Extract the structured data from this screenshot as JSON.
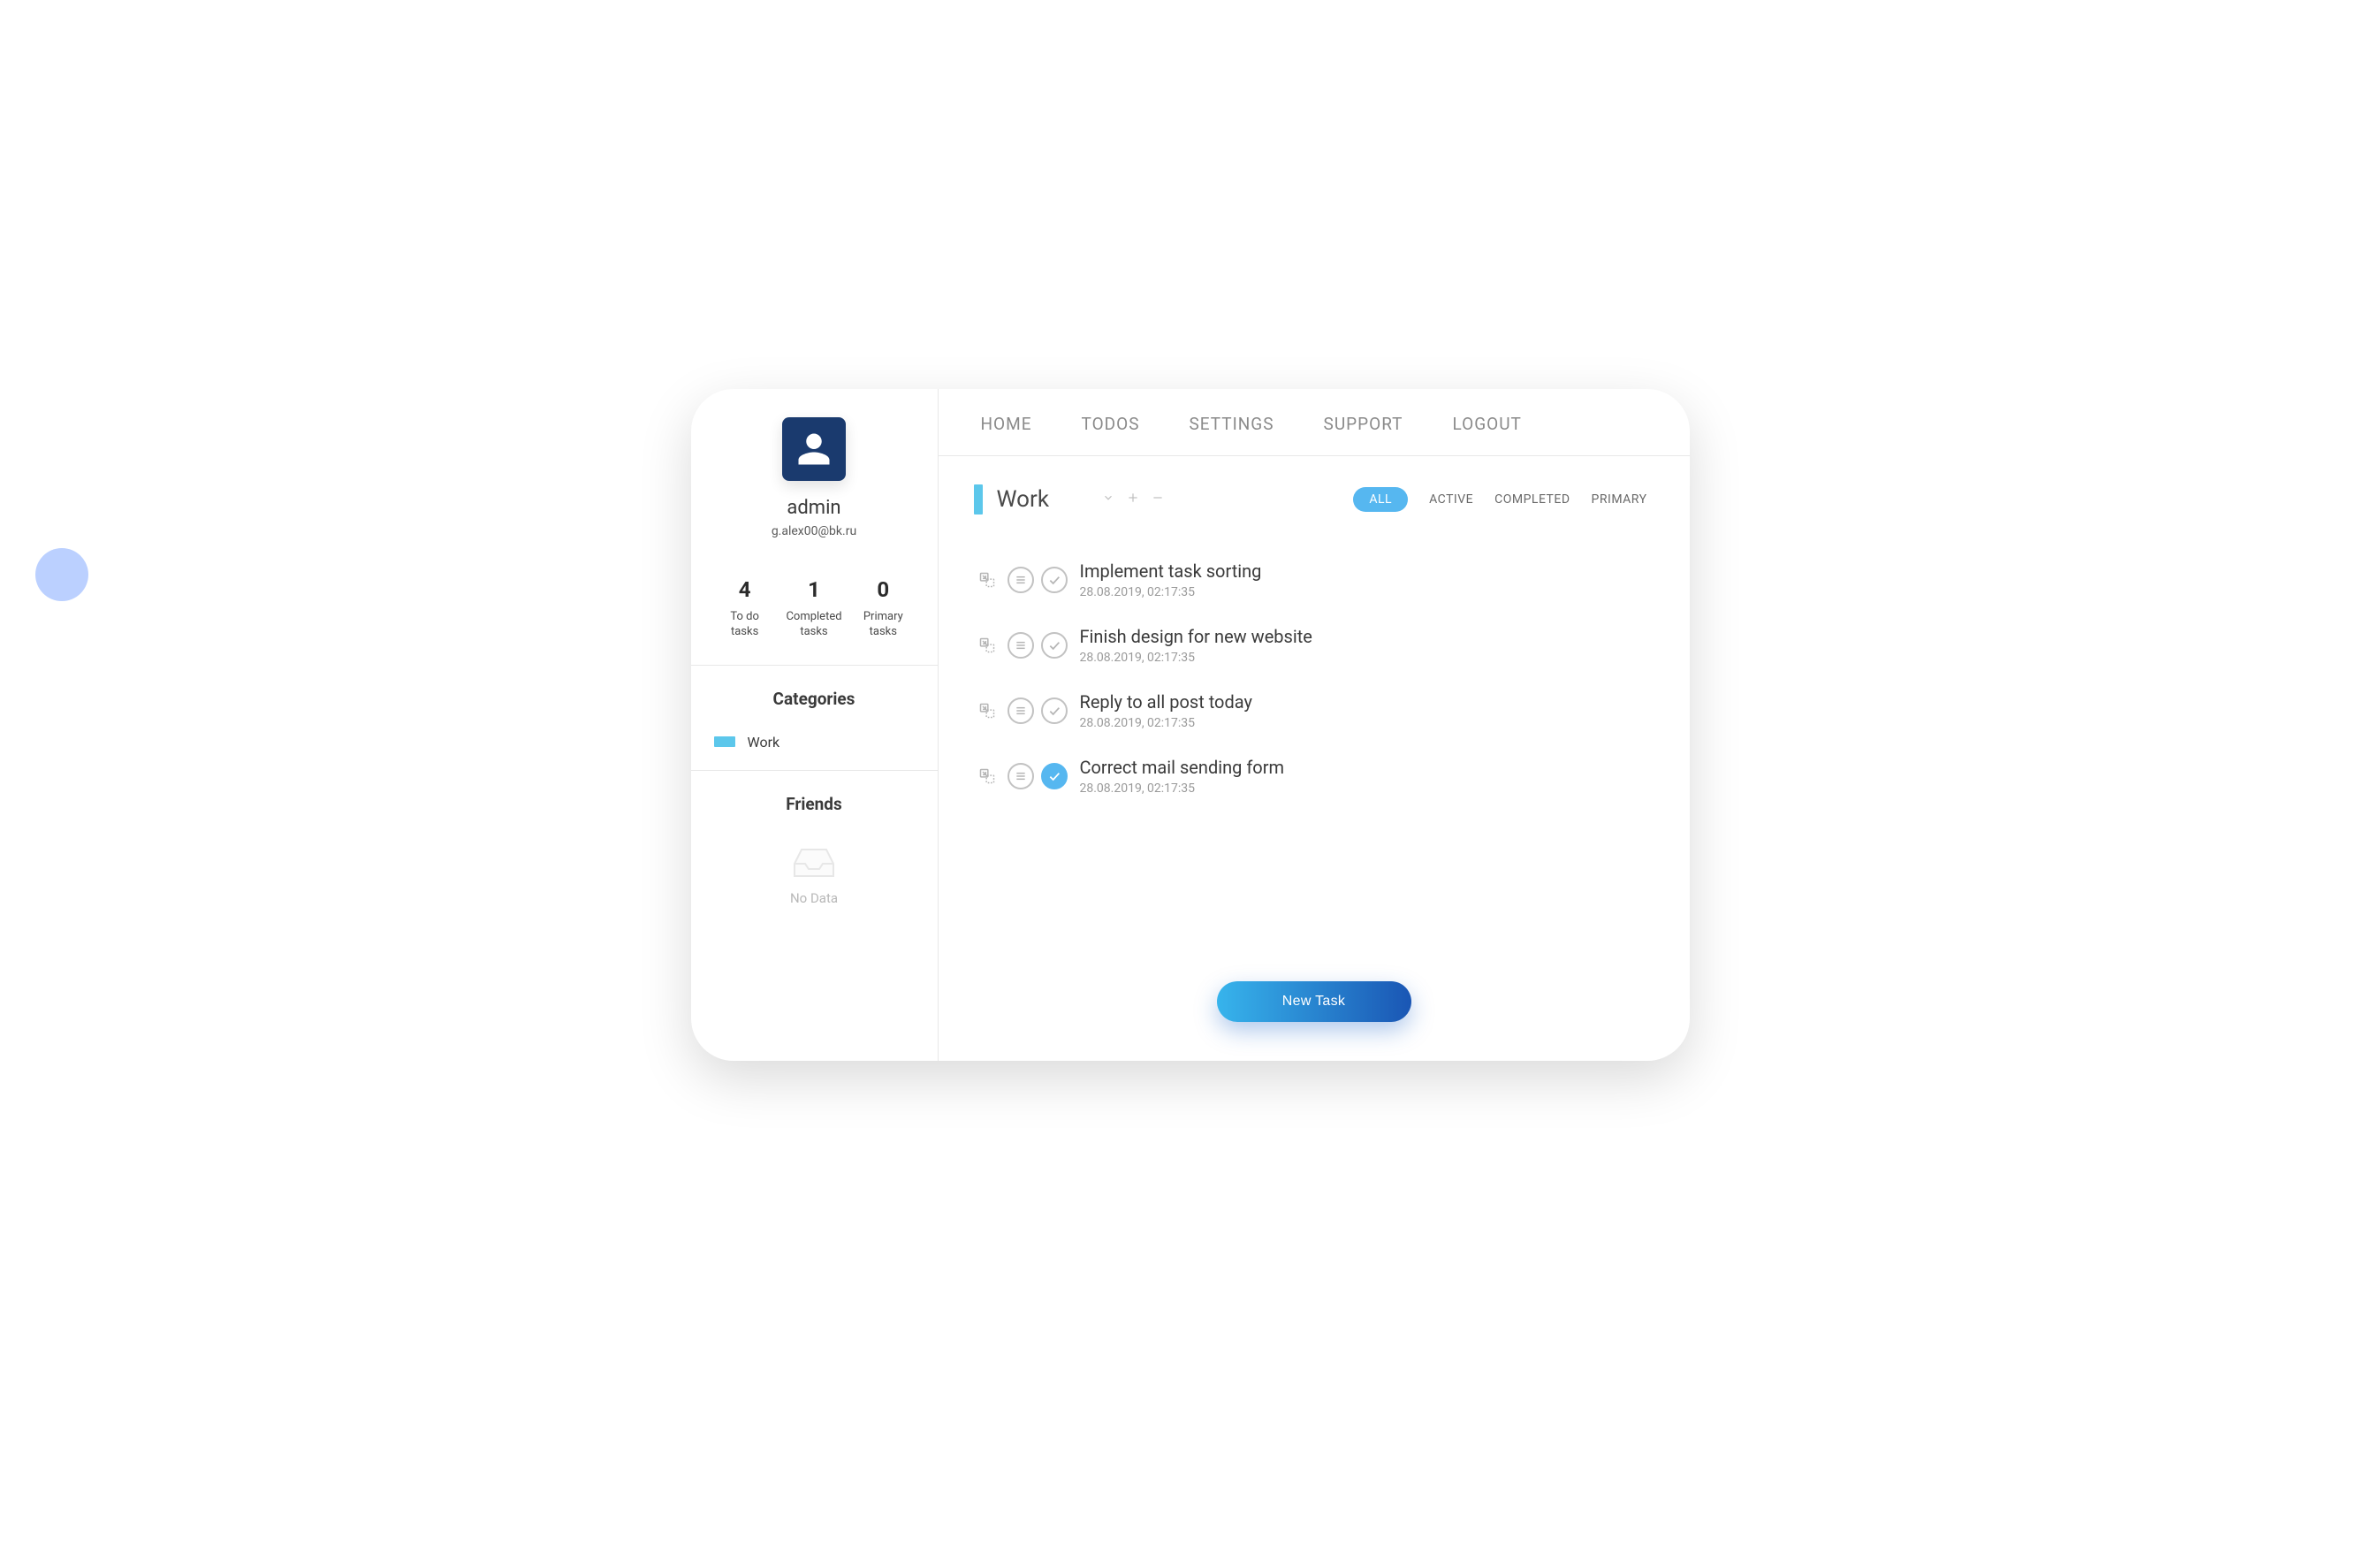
{
  "profile": {
    "username": "admin",
    "email": "g.alex00@bk.ru"
  },
  "stats": [
    {
      "value": "4",
      "label1": "To do",
      "label2": "tasks"
    },
    {
      "value": "1",
      "label1": "Completed",
      "label2": "tasks"
    },
    {
      "value": "0",
      "label1": "Primary",
      "label2": "tasks"
    }
  ],
  "sections": {
    "categories_title": "Categories",
    "friends_title": "Friends",
    "empty_label": "No Data"
  },
  "categories": [
    {
      "label": "Work",
      "color": "#5cc7eb"
    }
  ],
  "nav": {
    "home": "HOME",
    "todos": "TODOS",
    "settings": "SETTINGS",
    "support": "SUPPORT",
    "logout": "LOGOUT"
  },
  "list": {
    "title": "Work",
    "filters": {
      "all": "ALL",
      "active": "ACTIVE",
      "completed": "COMPLETED",
      "primary": "PRIMARY",
      "current": "all"
    }
  },
  "tasks": [
    {
      "title": "Implement task sorting",
      "time": "28.08.2019, 02:17:35",
      "done": false
    },
    {
      "title": "Finish design for new website",
      "time": "28.08.2019, 02:17:35",
      "done": false
    },
    {
      "title": "Reply to all post today",
      "time": "28.08.2019, 02:17:35",
      "done": false
    },
    {
      "title": "Correct mail sending form",
      "time": "28.08.2019, 02:17:35",
      "done": true
    }
  ],
  "buttons": {
    "new_task": "New Task"
  }
}
